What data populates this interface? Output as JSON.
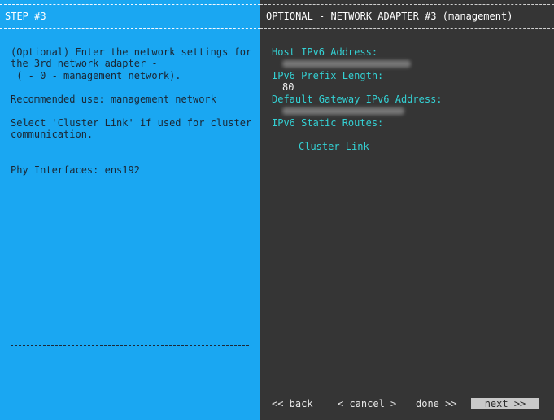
{
  "left": {
    "header": "STEP #3",
    "desc_line1": "(Optional) Enter the network settings for",
    "desc_line2": "the 3rd network adapter -",
    "desc_line3": " ( - 0 - management network).",
    "recommended": "Recommended use: management network",
    "cluster_line1": "Select 'Cluster Link' if used for cluster",
    "cluster_line2": "communication.",
    "phy_interfaces": "Phy Interfaces: ens192"
  },
  "right": {
    "header": "OPTIONAL - NETWORK ADAPTER #3 (management)",
    "host_ipv6_label": "Host IPv6 Address:",
    "prefix_label": "IPv6 Prefix Length:",
    "prefix_value": "80",
    "gateway_label": "Default Gateway IPv6 Address:",
    "static_routes_label": "IPv6 Static Routes:",
    "cluster_link": "Cluster Link"
  },
  "buttons": {
    "back": "<< back",
    "cancel": "< cancel >",
    "done": "done >>",
    "next": "next >>"
  },
  "colors": {
    "left_bg": "#1aa7f2",
    "right_bg": "#353535",
    "accent_teal": "#34d1d4"
  }
}
